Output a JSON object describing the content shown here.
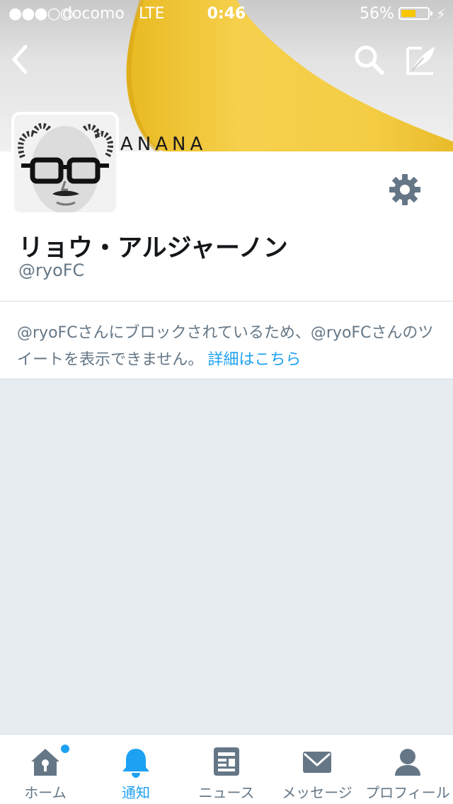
{
  "status_bar": {
    "signal": "●●●○○",
    "carrier": "docomo",
    "network": "LTE",
    "time": "0:46",
    "battery_percent": "56%",
    "battery_level": 0.56,
    "charging_icon": "bolt-icon"
  },
  "header": {
    "back_icon": "chevron-left-icon",
    "search_icon": "search-icon",
    "compose_icon": "compose-tweet-icon",
    "banner_text": "ANANA"
  },
  "profile": {
    "display_name": "リョウ・アルジャーノン",
    "handle": "@ryoFC",
    "settings_icon": "gear-icon"
  },
  "notice": {
    "message": "@ryoFCさんにブロックされているため、@ryoFCさんのツイートを表示できません。",
    "link_label": "詳細はこちら"
  },
  "tabs": [
    {
      "label": "ホーム",
      "icon": "home-icon",
      "active": false,
      "badge": true
    },
    {
      "label": "通知",
      "icon": "bell-icon",
      "active": true,
      "badge": false
    },
    {
      "label": "ニュース",
      "icon": "news-icon",
      "active": false,
      "badge": false
    },
    {
      "label": "メッセージ",
      "icon": "envelope-icon",
      "active": false,
      "badge": false
    },
    {
      "label": "プロフィール",
      "icon": "person-icon",
      "active": false,
      "badge": false
    }
  ],
  "colors": {
    "accent": "#1da1f2",
    "muted_text": "#657786",
    "background": "#e6ecf0",
    "battery": "#f7c600",
    "banana": "#f2c94c"
  }
}
